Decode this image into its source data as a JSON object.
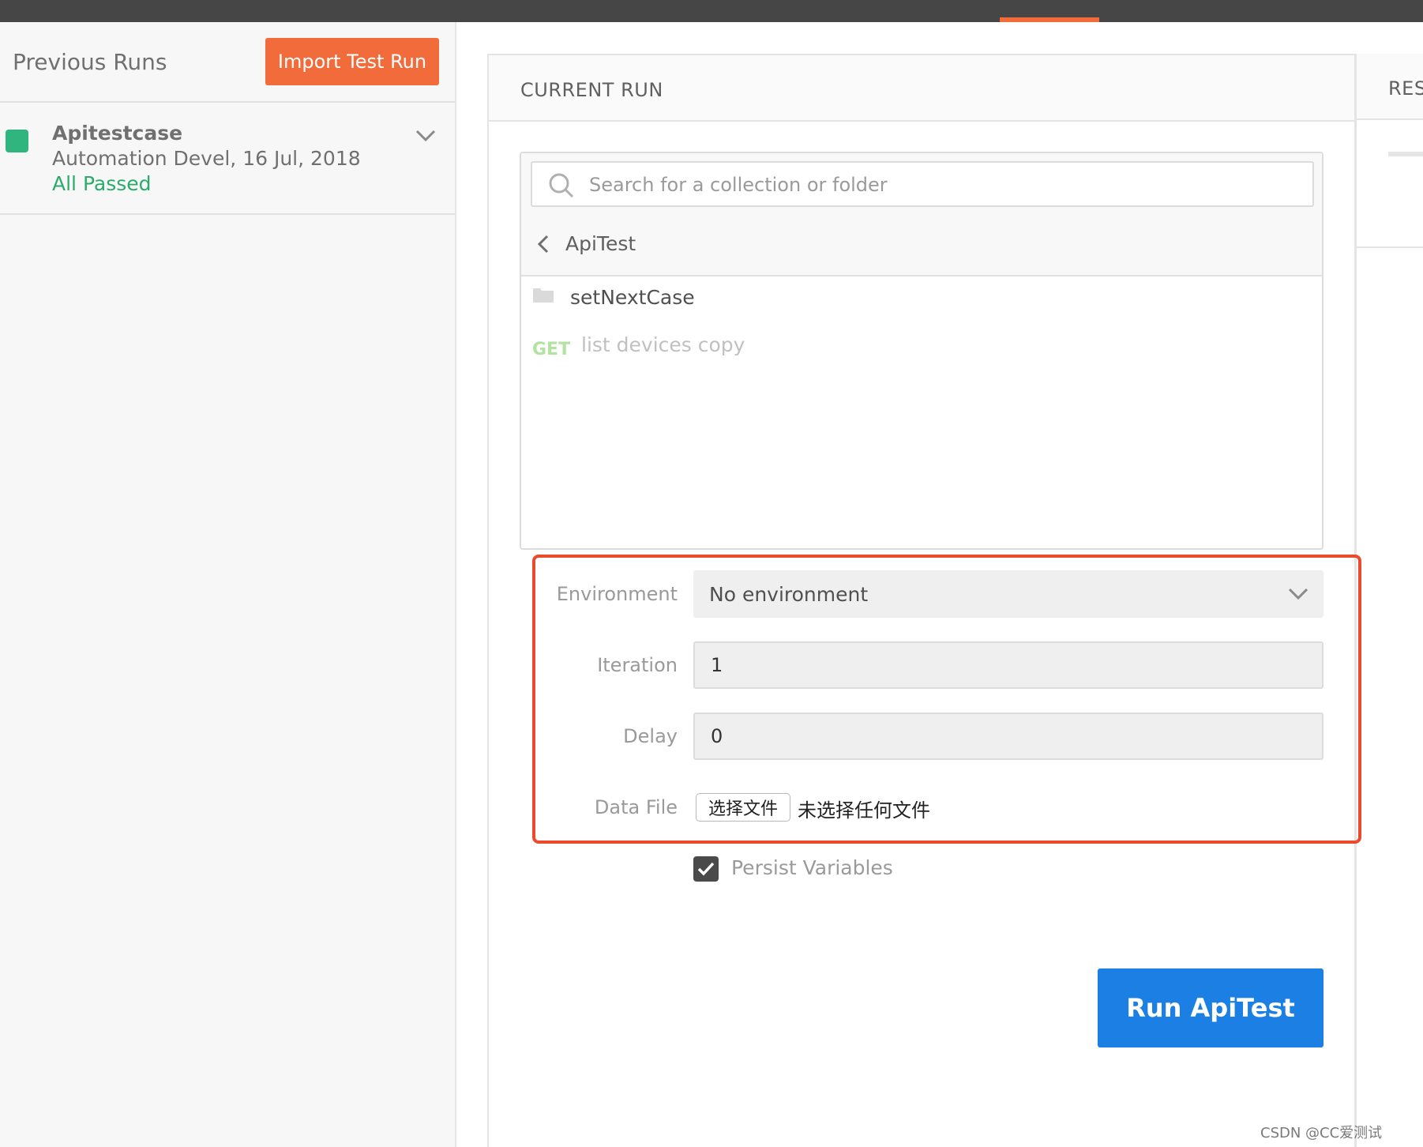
{
  "sidebar": {
    "title": "Previous Runs",
    "import_button": "Import Test Run",
    "runs": [
      {
        "name": "Apitestcase",
        "meta": "Automation Devel, 16 Jul, 2018",
        "result": "All Passed",
        "status_color": "#31b57e"
      }
    ]
  },
  "main": {
    "title": "CURRENT RUN",
    "search": {
      "placeholder": "Search for a collection or folder",
      "value": ""
    },
    "breadcrumb": "ApiTest",
    "items": [
      {
        "type": "folder",
        "label": "setNextCase",
        "icon": "folder-icon"
      },
      {
        "type": "request",
        "method": "GET",
        "label": "list devices copy"
      }
    ],
    "settings": {
      "environment_label": "Environment",
      "environment_value": "No environment",
      "iteration_label": "Iteration",
      "iteration_value": "1",
      "delay_label": "Delay",
      "delay_value": "0",
      "data_file_label": "Data File",
      "file_button": "选择文件",
      "file_status": "未选择任何文件"
    },
    "persist": {
      "label": "Persist Variables",
      "checked": true
    },
    "run_button": "Run ApiTest"
  },
  "results": {
    "title": "RESULTS"
  },
  "watermark": "CSDN @CC爱测试",
  "colors": {
    "accent_orange": "#f26b3a",
    "run_blue": "#1b7fe3",
    "passed_green": "#2bab6b",
    "highlight_red": "#ec4a2c",
    "titlebar": "#464646"
  }
}
